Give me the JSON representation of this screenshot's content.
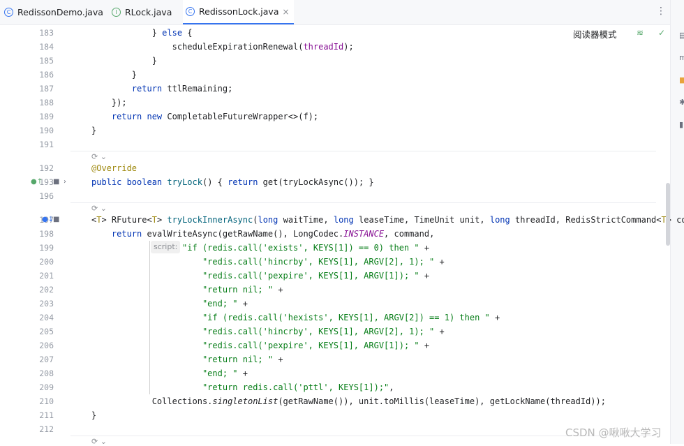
{
  "tabs": [
    {
      "label": "RedissonDemo.java",
      "icon": "C"
    },
    {
      "label": "RLock.java",
      "icon": "I"
    },
    {
      "label": "RedissonLock.java",
      "icon": "C",
      "close": "×"
    }
  ],
  "toolbar": {
    "more": "⋮",
    "reader_mode": "阅读器模式"
  },
  "editor": {
    "lines": [
      {
        "n": "183",
        "html": "            } <span class=\"kw\">else</span> {"
      },
      {
        "n": "184",
        "html": "                scheduleExpirationRenewal(<span class=\"pm\">threadId</span>);"
      },
      {
        "n": "185",
        "html": "            }"
      },
      {
        "n": "186",
        "html": "        }"
      },
      {
        "n": "187",
        "html": "        <span class=\"kw\">return</span> ttlRemaining;"
      },
      {
        "n": "188",
        "html": "    });"
      },
      {
        "n": "189",
        "html": "    <span class=\"kw\">return new</span> CompletableFutureWrapper&lt;&gt;(f);"
      },
      {
        "n": "190",
        "html": "}"
      },
      {
        "n": "191",
        "html": ""
      },
      {
        "n": "192",
        "html": "<span class=\"an\">@Override</span>"
      },
      {
        "n": "193",
        "html": "<span class=\"kw\">public boolean</span> <span class=\"fn\">tryLock</span>() { <span class=\"kw\">return</span> get(tryLockAsync()); }"
      },
      {
        "n": "196",
        "html": ""
      },
      {
        "n": "197",
        "html": "&lt;<span class=\"an\">T</span>&gt; RFuture&lt;<span class=\"an\">T</span>&gt; <span class=\"fn\">tryLockInnerAsync</span>(<span class=\"kw\">long</span> waitTime, <span class=\"kw\">long</span> leaseTime, TimeUnit unit, <span class=\"kw\">long</span> threadId, RedisStrictCommand&lt;<span class=\"an\">T</span>&gt; com"
      },
      {
        "n": "198",
        "html": "    <span class=\"kw\">return</span> evalWriteAsync(getRawName(), LongCodec.<span class=\"ic\">INSTANCE</span>, command,"
      },
      {
        "n": "199",
        "html": "                  <span class=\"st\">\"if (redis.call('exists', KEYS[1]) == 0) then \"</span> +"
      },
      {
        "n": "200",
        "html": "                      <span class=\"st\">\"redis.call('hincrby', KEYS[1], ARGV[2], 1); \"</span> +"
      },
      {
        "n": "201",
        "html": "                      <span class=\"st\">\"redis.call('pexpire', KEYS[1], ARGV[1]); \"</span> +"
      },
      {
        "n": "202",
        "html": "                      <span class=\"st\">\"return nil; \"</span> +"
      },
      {
        "n": "203",
        "html": "                      <span class=\"st\">\"end; \"</span> +"
      },
      {
        "n": "204",
        "html": "                      <span class=\"st\">\"if (redis.call('hexists', KEYS[1], ARGV[2]) == 1) then \"</span> +"
      },
      {
        "n": "205",
        "html": "                      <span class=\"st\">\"redis.call('hincrby', KEYS[1], ARGV[2], 1); \"</span> +"
      },
      {
        "n": "206",
        "html": "                      <span class=\"st\">\"redis.call('pexpire', KEYS[1], ARGV[1]); \"</span> +"
      },
      {
        "n": "207",
        "html": "                      <span class=\"st\">\"return nil; \"</span> +"
      },
      {
        "n": "208",
        "html": "                      <span class=\"st\">\"end; \"</span> +"
      },
      {
        "n": "209",
        "html": "                      <span class=\"st\">\"return redis.call('pttl', KEYS[1]);\"</span>,"
      },
      {
        "n": "210",
        "html": "            Collections.<span class=\"it\">singletonList</span>(getRawName()), unit.toMillis(leaseTime), getLockName(threadId));"
      },
      {
        "n": "211",
        "html": "}"
      },
      {
        "n": "212",
        "html": ""
      }
    ],
    "script_hint": "script:"
  },
  "watermark": "CSDN @啾啾大学习"
}
